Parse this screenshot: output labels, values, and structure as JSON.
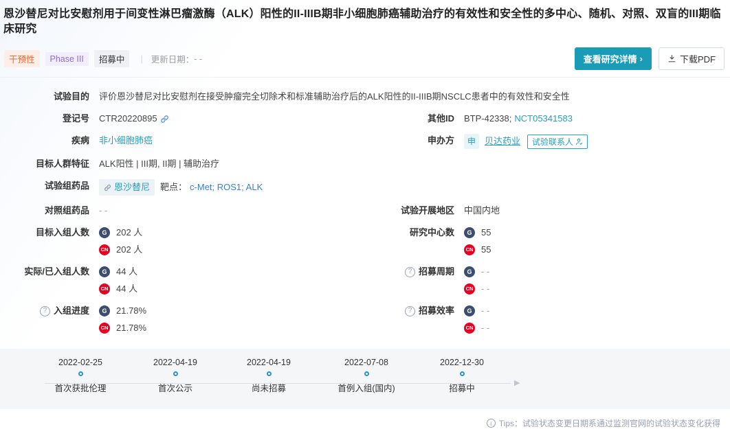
{
  "page": {
    "title": "恩沙替尼对比安慰剂用于间变性淋巴瘤激酶（ALK）阳性的II-IIIB期非小细胞肺癌辅助治疗的有效性和安全性的多中心、随机、对照、双盲的III期临床研究"
  },
  "header": {
    "tags": [
      {
        "label": "干预性",
        "type": "orange"
      },
      {
        "label": "Phase III",
        "type": "purple"
      },
      {
        "label": "招募中",
        "type": "gray"
      }
    ],
    "update_label": "更新日期：",
    "update_value": "- -",
    "view_details_label": "查看研究详情",
    "view_details_chevron": "›",
    "download_pdf_label": "下载PDF"
  },
  "fields": {
    "purpose": {
      "label": "试验目的",
      "value": "评价恩沙替尼对比安慰剂在接受肿瘤完全切除术和标准辅助治疗后的ALK阳性的II-IIIB期NSCLC患者中的有效性和安全性"
    },
    "registration": {
      "label": "登记号",
      "value": "CTR20220895"
    },
    "other_id": {
      "label": "其他ID",
      "value_plain": "BTP-42338;",
      "link": "NCT05341583"
    },
    "disease": {
      "label": "疾病",
      "value": "非小细胞肺癌"
    },
    "sponsor": {
      "label": "申办方",
      "badge": "申",
      "name": "贝达药业",
      "contact_label": "试验联系人"
    },
    "population": {
      "label": "目标人群特征",
      "value": "ALK阳性 | III期, II期 | 辅助治疗"
    },
    "trial_drug": {
      "label": "试验组药品",
      "drug": "恩沙替尼",
      "target_label": "靶点：",
      "targets": "c-Met; ROS1; ALK"
    },
    "control_drug": {
      "label": "对照组药品",
      "value": "- -"
    },
    "region": {
      "label": "试验开展地区",
      "value": "中国内地"
    },
    "target_enrollment": {
      "label": "目标入组人数",
      "global": "202 人",
      "cn": "202 人"
    },
    "centers": {
      "label": "研究中心数",
      "global": "55",
      "cn": "55"
    },
    "actual_enrollment": {
      "label": "实际/已入组人数",
      "global": "44 人",
      "cn": "44 人"
    },
    "recruit_period": {
      "label": "招募周期",
      "global": "- -",
      "cn": "- -"
    },
    "progress": {
      "label": "入组进度",
      "global": "21.78%",
      "cn": "21.78%"
    },
    "recruit_efficiency": {
      "label": "招募效率",
      "global": "- -",
      "cn": "- -"
    }
  },
  "icons": {
    "global_badge": "G",
    "cn_badge": "CN",
    "help": "?",
    "info": "i"
  },
  "timeline": {
    "milestones": [
      {
        "date": "2022-02-25",
        "label": "首次获批伦理"
      },
      {
        "date": "2022-04-19",
        "label": "首次公示"
      },
      {
        "date": "2022-04-19",
        "label": "尚未招募"
      },
      {
        "date": "2022-07-08",
        "label": "首例入组(国内)"
      },
      {
        "date": "2022-12-30",
        "label": "招募中"
      }
    ],
    "arrow": "▶"
  },
  "tips": {
    "text": "Tips：试验状态变更日期系通过监测官网的试验状态变化获得"
  },
  "colors": {
    "accent_teal": "#1a9cb7",
    "link_teal": "#2a9db8",
    "link_blue": "#3a7fc9",
    "tag_orange": "#f0683b",
    "tag_purple": "#8d6ecb",
    "cn_red": "#e60023",
    "global_navy": "#3d4d6d",
    "timeline_dot_blue": "#2e8fcc",
    "timeline_bg": "#f5f6f8"
  }
}
